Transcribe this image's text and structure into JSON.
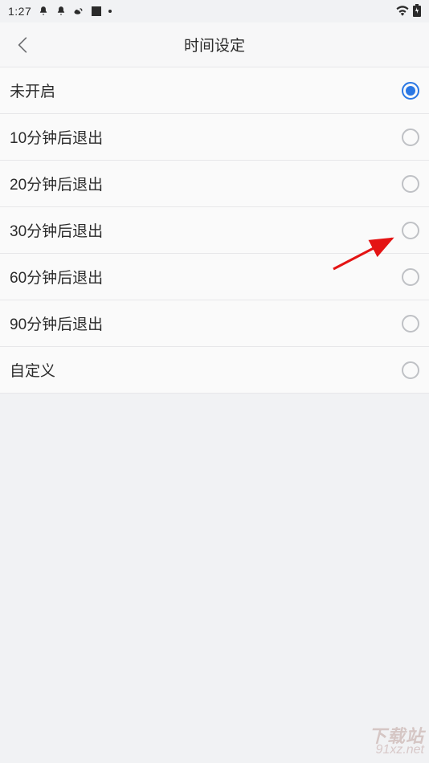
{
  "status": {
    "time": "1:27",
    "notifications": [
      "bell",
      "bell",
      "weibo",
      "square",
      "dot"
    ]
  },
  "header": {
    "title": "时间设定"
  },
  "options": [
    {
      "label": "未开启",
      "selected": true
    },
    {
      "label": "10分钟后退出",
      "selected": false
    },
    {
      "label": "20分钟后退出",
      "selected": false
    },
    {
      "label": "30分钟后退出",
      "selected": false
    },
    {
      "label": "60分钟后退出",
      "selected": false
    },
    {
      "label": "90分钟后退出",
      "selected": false
    },
    {
      "label": "自定义",
      "selected": false
    }
  ],
  "watermark": {
    "line1": "下载站",
    "line2": "91xz.net"
  }
}
